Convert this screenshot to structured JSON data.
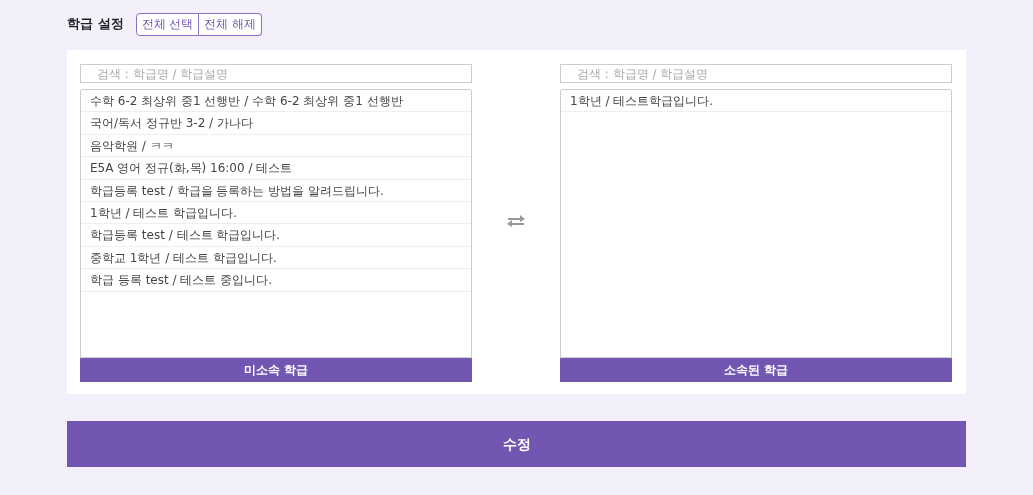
{
  "header": {
    "title": "학급 설정",
    "buttons": [
      "전체 선택",
      "전체 해제"
    ]
  },
  "lists": [
    {
      "search": {
        "placeholder": "검색 : 학급명 / 학급설명"
      },
      "items": [
        "수학 6-2 최상위 중1 선행반 / 수학 6-2 최상위 중1 선행반",
        "국어/독서 정규반 3-2 / 가나다",
        "음악학원 / ㅋㅋ",
        "E5A 영어 정규(화,목) 16:00 / 테스트",
        "학급등록 test / 학급을 등록하는 방법을 알려드립니다.",
        "1학년 / 테스트 학급입니다.",
        "학급등록 test / 테스트 학급입니다.",
        "중학교 1학년 / 테스트 학급입니다.",
        "학급 등록 test / 테스트 중입니다."
      ],
      "footer": "미소속 학급"
    },
    {
      "search": {
        "placeholder": "검색 : 학급명 / 학급설명"
      },
      "items": [
        "1학년 / 테스트학급입니다."
      ],
      "footer": "소속된 학급"
    }
  ],
  "submit": "수정"
}
